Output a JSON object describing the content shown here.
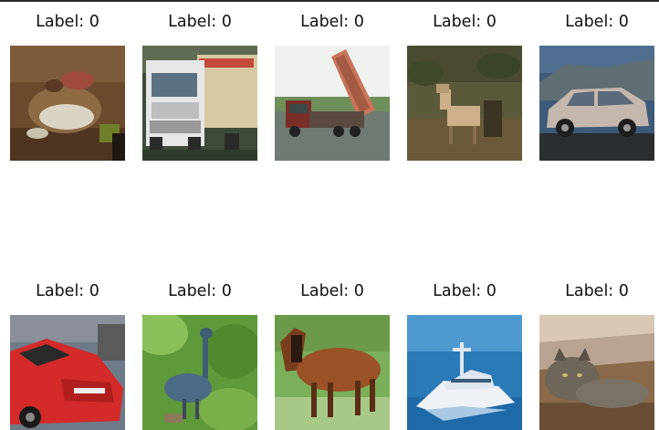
{
  "grid": {
    "items": [
      {
        "label": "Label: 0",
        "icon": "frog-photo-icon"
      },
      {
        "label": "Label: 0",
        "icon": "truck-photo-icon"
      },
      {
        "label": "Label: 0",
        "icon": "dump-truck-photo-icon"
      },
      {
        "label": "Label: 0",
        "icon": "deer-photo-icon"
      },
      {
        "label": "Label: 0",
        "icon": "car-photo-icon"
      },
      {
        "label": "Label: 0",
        "icon": "red-car-photo-icon"
      },
      {
        "label": "Label: 0",
        "icon": "bird-photo-icon"
      },
      {
        "label": "Label: 0",
        "icon": "horse-photo-icon"
      },
      {
        "label": "Label: 0",
        "icon": "ship-photo-icon"
      },
      {
        "label": "Label: 0",
        "icon": "cat-photo-icon"
      }
    ]
  }
}
